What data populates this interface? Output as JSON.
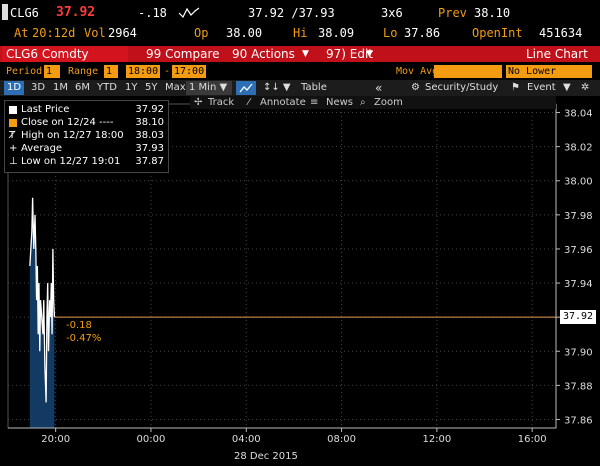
{
  "quote": {
    "ticker": "CLG6",
    "last": "37.92",
    "change": "-.18",
    "bid_ask": "37.92 /37.93",
    "size": "3x6",
    "prev_label": "Prev",
    "prev": "38.10",
    "at_label": "At",
    "at_time": "20:12d",
    "vol_label": "Vol",
    "vol": "2964",
    "op_label": "Op",
    "op": "38.00",
    "hi_label": "Hi",
    "hi": "38.09",
    "lo_label": "Lo",
    "lo": "37.86",
    "openint_label": "OpenInt",
    "openint": "451634"
  },
  "menu": {
    "security": "CLG6 Comdty",
    "compare": "99 Compare",
    "actions": "90 Actions",
    "edit": "97) Edit",
    "chart_type": "Line Chart"
  },
  "controls": {
    "period_label": "Period",
    "period_value": "1",
    "range_label": "Range",
    "range_value": "1",
    "time_from": "18:00",
    "time_sep": "-",
    "time_to": "17:00",
    "mov_avg_label": "Mov Avg",
    "lower_chart": "No Lower Chart"
  },
  "toolbar": {
    "ranges": [
      "1D",
      "3D",
      "1M",
      "6M",
      "YTD",
      "1Y",
      "5Y",
      "Max"
    ],
    "interval": "1 Min",
    "table": "Table",
    "collapse": "«",
    "security_study": "Security/Study",
    "event": "Event"
  },
  "subtoolbar": {
    "track": "Track",
    "annotate": "Annotate",
    "news": "News",
    "zoom": "Zoom"
  },
  "legend": [
    {
      "label": "Last Price",
      "value": "37.92"
    },
    {
      "label": "Close on 12/24 ----",
      "value": "38.10"
    },
    {
      "label": "High on 12/27 18:00",
      "value": "38.03"
    },
    {
      "label": "Average",
      "value": "37.93"
    },
    {
      "label": "Low on 12/27 19:01",
      "value": "37.87"
    }
  ],
  "chart_annotations": {
    "change_abs": "-0.18",
    "change_pct": "-0.47%",
    "last_tag": "37.92",
    "date_label": "28 Dec 2015"
  },
  "colors": {
    "accent_amber": "#f39c12",
    "menu_red": "#c0101a",
    "price_line": "#ffffff",
    "area_fill": "#123a63",
    "prev_close_line": "#e39b4c"
  },
  "chart_data": {
    "type": "area",
    "title": "",
    "xlabel": "28 Dec 2015",
    "ylabel": "",
    "x_ticks": [
      "20:00",
      "00:00",
      "04:00",
      "08:00",
      "12:00",
      "16:00"
    ],
    "y_ticks": [
      37.86,
      37.88,
      37.9,
      37.92,
      37.94,
      37.96,
      37.98,
      38.0,
      38.02,
      38.04
    ],
    "ylim": [
      37.855,
      38.045
    ],
    "grid": true,
    "reference_lines": [
      {
        "name": "Close on 12/24",
        "value": 38.1
      },
      {
        "name": "Last Price",
        "value": 37.92
      }
    ],
    "series": [
      {
        "name": "Last Price",
        "x": [
          "18:55",
          "19:00",
          "19:02",
          "19:05",
          "19:08",
          "19:10",
          "19:12",
          "19:14",
          "19:16",
          "19:18",
          "19:20",
          "19:22",
          "19:25",
          "19:28",
          "19:30",
          "19:33",
          "19:36",
          "19:38",
          "19:40",
          "19:42",
          "19:45",
          "19:47",
          "19:49",
          "19:51",
          "19:53",
          "19:55",
          "19:57"
        ],
        "values": [
          37.95,
          37.97,
          37.99,
          37.96,
          37.98,
          37.96,
          37.93,
          37.95,
          37.91,
          37.94,
          37.9,
          37.93,
          37.92,
          37.91,
          37.93,
          37.89,
          37.87,
          37.92,
          37.94,
          37.9,
          37.93,
          37.92,
          37.94,
          37.91,
          37.96,
          37.93,
          37.92
        ]
      }
    ]
  }
}
